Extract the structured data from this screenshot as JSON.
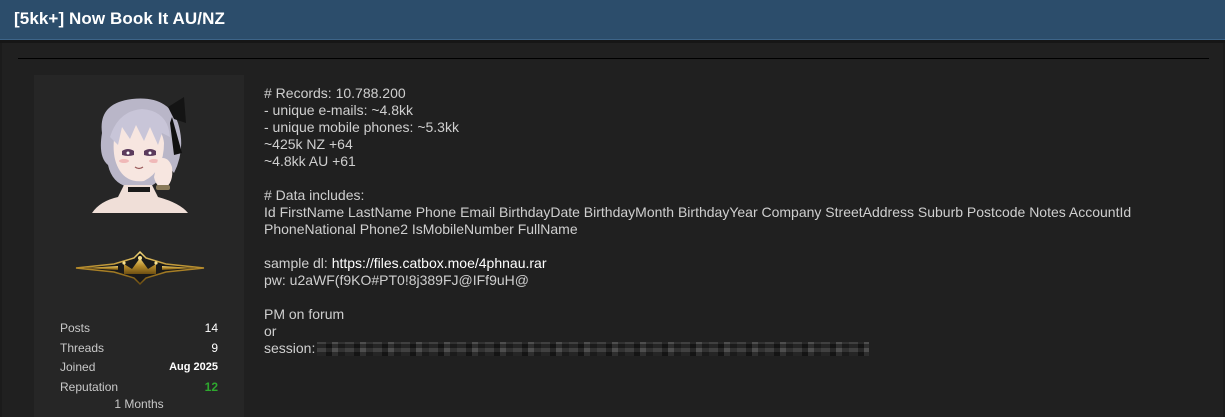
{
  "thread": {
    "title": "[5kk+] Now Book It AU/NZ"
  },
  "user": {
    "avatar_icon": "anime-girl-avatar-icon",
    "rank_icon": "gold-crown-rank-badge-icon",
    "stats": [
      {
        "label": "Posts",
        "value": "14"
      },
      {
        "label": "Threads",
        "value": "9"
      },
      {
        "label": "Joined",
        "value": "Aug 2025"
      },
      {
        "label": "Reputation",
        "value": "12"
      }
    ],
    "membership": "1 Months",
    "reputation_color": "#2ea82e"
  },
  "post": {
    "records": "# Records: 10.788.200",
    "unique_emails": "- unique e-mails: ~4.8kk",
    "unique_phones": "- unique mobile phones: ~5.3kk",
    "nz": "~425k NZ +64",
    "au": "~4.8kk AU +61",
    "data_heading": "# Data includes:",
    "fields_line1": "Id FirstName LastName Phone Email BirthdayDate BirthdayMonth BirthdayYear Company StreetAddress Suburb Postcode Notes AccountId",
    "fields_line2": "PhoneNational Phone2 IsMobileNumber FullName",
    "sample_label": "sample dl: ",
    "sample_link": "https://files.catbox.moe/4phnau.rar",
    "password": "pw: u2aWF(f9KO#PT0!8j389FJ@IFf9uH@",
    "pm": "PM on forum",
    "or": "or",
    "session_label": "session:"
  },
  "colors": {
    "header_bg": "#2c4d6b",
    "page_bg": "#1b1b1b",
    "post_bg": "#202020",
    "panel_bg": "#262626"
  }
}
